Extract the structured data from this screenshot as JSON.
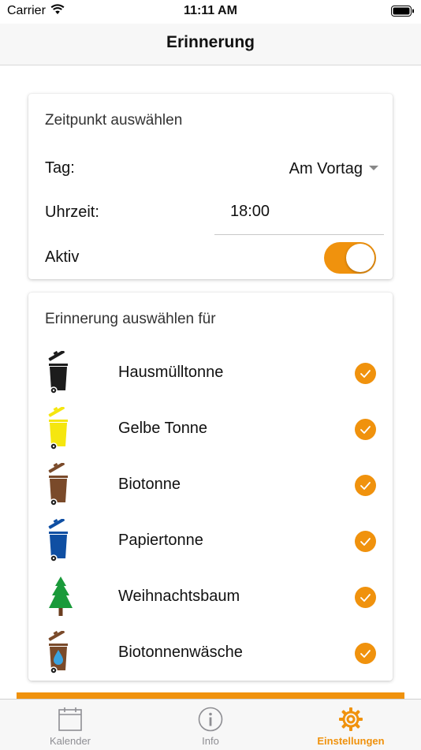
{
  "status": {
    "carrier": "Carrier",
    "time": "11:11 AM"
  },
  "nav": {
    "title": "Erinnerung"
  },
  "time_card": {
    "title": "Zeitpunkt auswählen",
    "day_label": "Tag:",
    "day_value": "Am Vortag",
    "time_label": "Uhrzeit:",
    "time_value": "18:00",
    "active_label": "Aktiv",
    "active": true
  },
  "bins_card": {
    "title": "Erinnerung auswählen für",
    "items": [
      {
        "label": "Hausmülltonne",
        "icon": "black-bin-icon",
        "color": "#1c1c1c",
        "checked": true
      },
      {
        "label": "Gelbe Tonne",
        "icon": "yellow-bin-icon",
        "color": "#f5e60f",
        "checked": true
      },
      {
        "label": "Biotonne",
        "icon": "brown-bin-icon",
        "color": "#7a4a2a",
        "checked": true
      },
      {
        "label": "Papiertonne",
        "icon": "blue-bin-icon",
        "color": "#0f4fa3",
        "checked": true
      },
      {
        "label": "Weihnachtsbaum",
        "icon": "christmas-tree-icon",
        "color": "#1a9a3a",
        "checked": true
      },
      {
        "label": "Biotonnenwäsche",
        "icon": "brown-bin-water-drop-icon",
        "color": "#7a4a2a",
        "checked": true
      }
    ]
  },
  "tabs": [
    {
      "label": "Kalender",
      "icon": "calendar-icon",
      "active": false
    },
    {
      "label": "Info",
      "icon": "info-icon",
      "active": false
    },
    {
      "label": "Einstellungen",
      "icon": "gear-icon",
      "active": true
    }
  ],
  "colors": {
    "accent": "#f0920d",
    "background": "#ffffff",
    "bar": "#f7f7f7"
  }
}
